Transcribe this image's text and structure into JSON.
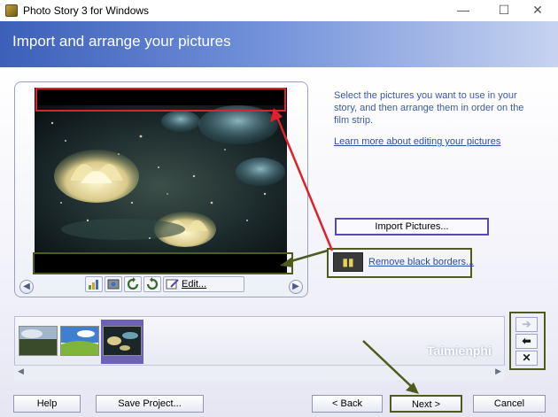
{
  "window": {
    "title": "Photo Story 3 for Windows",
    "minimize": "—",
    "maximize": "☐",
    "close": "✕"
  },
  "header": {
    "title": "Import and arrange your pictures"
  },
  "preview": {
    "image": "fractal lotus flowers on dark sparkling background",
    "edit_label": "Edit..."
  },
  "right": {
    "description": "Select the pictures you want to use in your story, and then arrange them in order on the film strip.",
    "learn_more": "Learn more about editing your pictures",
    "import_button": "Import Pictures...",
    "remove_borders": "Remove black borders..."
  },
  "filmstrip": {
    "thumbnails": [
      "landscape with cloudy sky",
      "green hills under blue sky",
      "fractal lotus flowers"
    ],
    "selected_index": 2
  },
  "watermark": "Taimienphi",
  "footer": {
    "help": "Help",
    "save_project": "Save Project...",
    "back": "< Back",
    "next": "Next >",
    "cancel": "Cancel"
  },
  "colors": {
    "highlight_red": "#e0202a",
    "highlight_green": "#4e5b1c",
    "header_blue": "#3c5fb8"
  }
}
